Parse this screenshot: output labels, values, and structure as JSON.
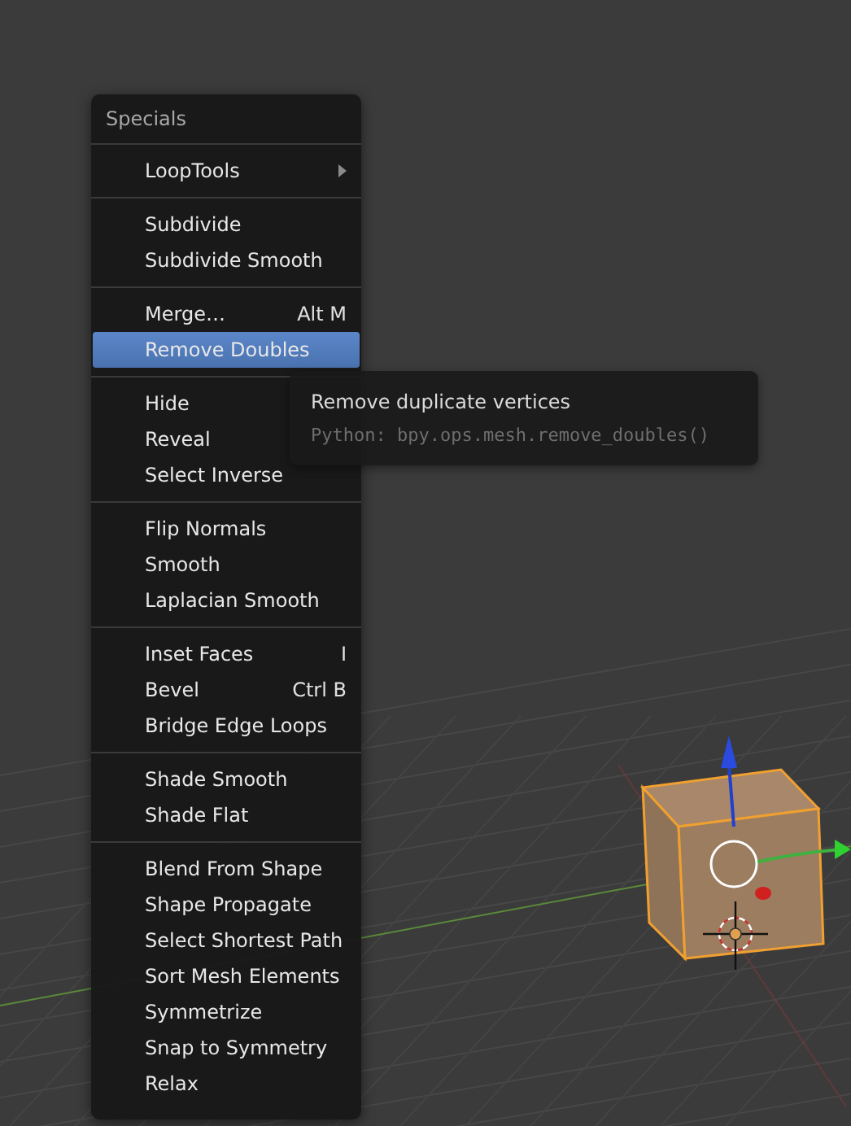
{
  "menu": {
    "title": "Specials",
    "sections": [
      [
        {
          "label": "LoopTools",
          "submenu": true,
          "selected": false
        }
      ],
      [
        {
          "label": "Subdivide",
          "selected": false
        },
        {
          "label": "Subdivide Smooth",
          "selected": false
        }
      ],
      [
        {
          "label": "Merge…",
          "shortcut": "Alt M",
          "selected": false
        },
        {
          "label": "Remove Doubles",
          "selected": true
        }
      ],
      [
        {
          "label": "Hide",
          "selected": false
        },
        {
          "label": "Reveal",
          "selected": false
        },
        {
          "label": "Select Inverse",
          "selected": false
        }
      ],
      [
        {
          "label": "Flip Normals",
          "selected": false
        },
        {
          "label": "Smooth",
          "selected": false
        },
        {
          "label": "Laplacian Smooth",
          "selected": false
        }
      ],
      [
        {
          "label": "Inset Faces",
          "shortcut": "I",
          "selected": false
        },
        {
          "label": "Bevel",
          "shortcut": "Ctrl B",
          "selected": false
        },
        {
          "label": "Bridge Edge Loops",
          "selected": false
        }
      ],
      [
        {
          "label": "Shade Smooth",
          "selected": false
        },
        {
          "label": "Shade Flat",
          "selected": false
        }
      ],
      [
        {
          "label": "Blend From Shape",
          "selected": false
        },
        {
          "label": "Shape Propagate",
          "selected": false
        },
        {
          "label": "Select Shortest Path",
          "selected": false
        },
        {
          "label": "Sort Mesh Elements",
          "selected": false
        },
        {
          "label": "Symmetrize",
          "selected": false
        },
        {
          "label": "Snap to Symmetry",
          "selected": false
        },
        {
          "label": "Relax",
          "selected": false
        }
      ]
    ]
  },
  "tooltip": {
    "description": "Remove duplicate vertices",
    "python": "Python: bpy.ops.mesh.remove_doubles()"
  }
}
